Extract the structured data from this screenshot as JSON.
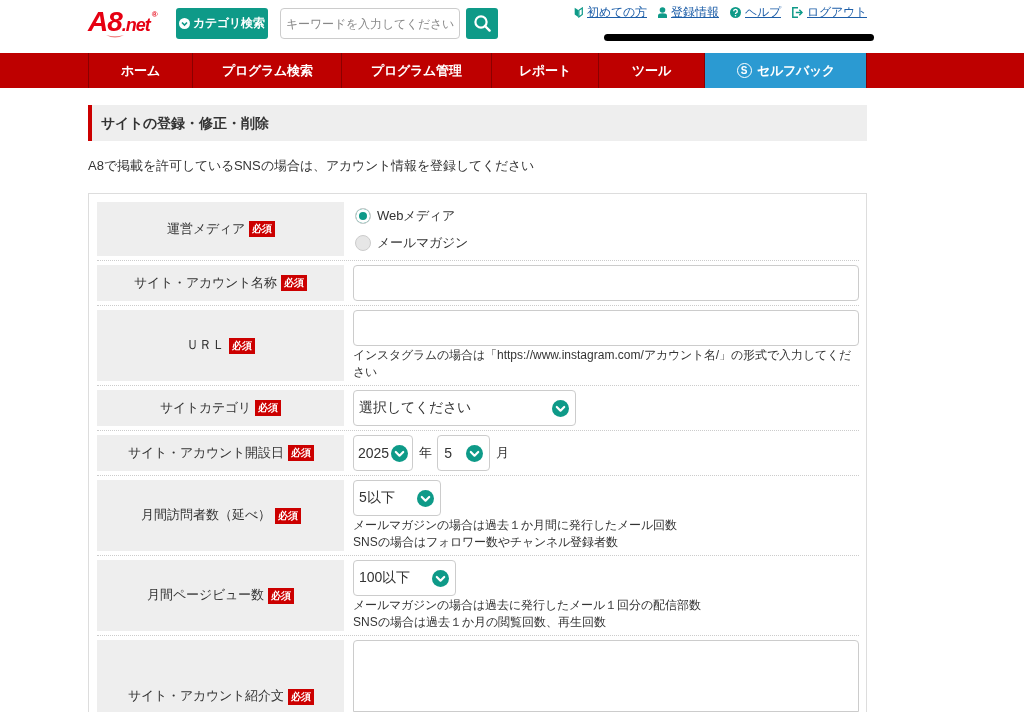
{
  "header": {
    "logo": {
      "main": "A8",
      "suffix": ".net",
      "mark": "®"
    },
    "category_button": "カテゴリ検索",
    "search": {
      "placeholder": "キーワードを入力してください"
    },
    "links": [
      {
        "kind": "beginner",
        "label": "初めての方"
      },
      {
        "kind": "account",
        "label": "登録情報"
      },
      {
        "kind": "help",
        "label": "ヘルプ"
      },
      {
        "kind": "logout",
        "label": "ログアウト"
      }
    ]
  },
  "nav": [
    {
      "label": "ホーム",
      "selected": false
    },
    {
      "label": "プログラム検索",
      "selected": false
    },
    {
      "label": "プログラム管理",
      "selected": false
    },
    {
      "label": "レポート",
      "selected": false
    },
    {
      "label": "ツール",
      "selected": false
    },
    {
      "label": "セルフバック",
      "selected": true,
      "icon": "S"
    }
  ],
  "section": {
    "title": "サイトの登録・修正・削除",
    "intro": "A8で掲載を許可しているSNSの場合は、アカウント情報を登録してください"
  },
  "form": {
    "rows": [
      {
        "label": "運営メディア",
        "badge": "必須",
        "kind": "radio",
        "options": [
          {
            "label": "Webメディア",
            "selected": true
          },
          {
            "label": "メールマガジン",
            "selected": false
          }
        ]
      },
      {
        "label": "サイト・アカウント名称",
        "badge": "必須",
        "kind": "text"
      },
      {
        "label": "ＵＲＬ",
        "badge": "必須",
        "kind": "text",
        "notes": [
          "インスタグラムの場合は「https://www.instagram.com/アカウント名/」の形式で入力してください"
        ]
      },
      {
        "label": "サイトカテゴリ",
        "badge": "必須",
        "kind": "select",
        "selects": [
          {
            "value": "選択してください"
          }
        ]
      },
      {
        "label": "サイト・アカウント開設日",
        "badge": "必須",
        "kind": "select",
        "selects": [
          {
            "value": "2025",
            "suffix": "年"
          },
          {
            "value": "5",
            "suffix": "月"
          }
        ]
      },
      {
        "label": "月間訪問者数（延べ）",
        "badge": "必須",
        "kind": "select",
        "selects": [
          {
            "value": "5以下"
          }
        ],
        "notes": [
          "メールマガジンの場合は過去１か月間に発行したメール回数",
          "SNSの場合はフォロワー数やチャンネル登録者数"
        ]
      },
      {
        "label": "月間ページビュー数",
        "badge": "必須",
        "kind": "select",
        "selects": [
          {
            "value": "100以下"
          }
        ],
        "notes": [
          "メールマガジンの場合は過去に発行したメール１回分の配信部数",
          "SNSの場合は過去１か月の閲覧回数、再生回数"
        ]
      },
      {
        "label": "サイト・アカウント紹介文",
        "badge": "必須",
        "kind": "textarea"
      }
    ]
  }
}
